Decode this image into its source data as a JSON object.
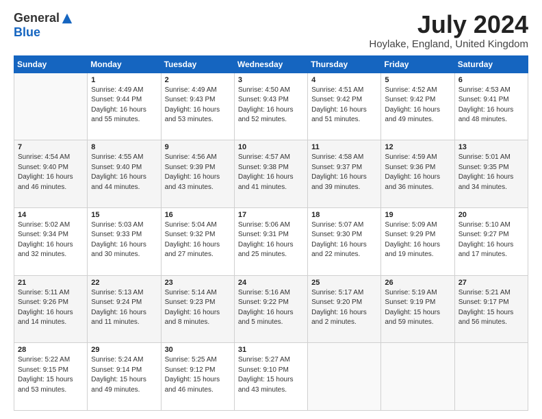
{
  "logo": {
    "general": "General",
    "blue": "Blue"
  },
  "title": "July 2024",
  "location": "Hoylake, England, United Kingdom",
  "days_of_week": [
    "Sunday",
    "Monday",
    "Tuesday",
    "Wednesday",
    "Thursday",
    "Friday",
    "Saturday"
  ],
  "weeks": [
    [
      {
        "day": "",
        "info": ""
      },
      {
        "day": "1",
        "info": "Sunrise: 4:49 AM\nSunset: 9:44 PM\nDaylight: 16 hours\nand 55 minutes."
      },
      {
        "day": "2",
        "info": "Sunrise: 4:49 AM\nSunset: 9:43 PM\nDaylight: 16 hours\nand 53 minutes."
      },
      {
        "day": "3",
        "info": "Sunrise: 4:50 AM\nSunset: 9:43 PM\nDaylight: 16 hours\nand 52 minutes."
      },
      {
        "day": "4",
        "info": "Sunrise: 4:51 AM\nSunset: 9:42 PM\nDaylight: 16 hours\nand 51 minutes."
      },
      {
        "day": "5",
        "info": "Sunrise: 4:52 AM\nSunset: 9:42 PM\nDaylight: 16 hours\nand 49 minutes."
      },
      {
        "day": "6",
        "info": "Sunrise: 4:53 AM\nSunset: 9:41 PM\nDaylight: 16 hours\nand 48 minutes."
      }
    ],
    [
      {
        "day": "7",
        "info": "Sunrise: 4:54 AM\nSunset: 9:40 PM\nDaylight: 16 hours\nand 46 minutes."
      },
      {
        "day": "8",
        "info": "Sunrise: 4:55 AM\nSunset: 9:40 PM\nDaylight: 16 hours\nand 44 minutes."
      },
      {
        "day": "9",
        "info": "Sunrise: 4:56 AM\nSunset: 9:39 PM\nDaylight: 16 hours\nand 43 minutes."
      },
      {
        "day": "10",
        "info": "Sunrise: 4:57 AM\nSunset: 9:38 PM\nDaylight: 16 hours\nand 41 minutes."
      },
      {
        "day": "11",
        "info": "Sunrise: 4:58 AM\nSunset: 9:37 PM\nDaylight: 16 hours\nand 39 minutes."
      },
      {
        "day": "12",
        "info": "Sunrise: 4:59 AM\nSunset: 9:36 PM\nDaylight: 16 hours\nand 36 minutes."
      },
      {
        "day": "13",
        "info": "Sunrise: 5:01 AM\nSunset: 9:35 PM\nDaylight: 16 hours\nand 34 minutes."
      }
    ],
    [
      {
        "day": "14",
        "info": "Sunrise: 5:02 AM\nSunset: 9:34 PM\nDaylight: 16 hours\nand 32 minutes."
      },
      {
        "day": "15",
        "info": "Sunrise: 5:03 AM\nSunset: 9:33 PM\nDaylight: 16 hours\nand 30 minutes."
      },
      {
        "day": "16",
        "info": "Sunrise: 5:04 AM\nSunset: 9:32 PM\nDaylight: 16 hours\nand 27 minutes."
      },
      {
        "day": "17",
        "info": "Sunrise: 5:06 AM\nSunset: 9:31 PM\nDaylight: 16 hours\nand 25 minutes."
      },
      {
        "day": "18",
        "info": "Sunrise: 5:07 AM\nSunset: 9:30 PM\nDaylight: 16 hours\nand 22 minutes."
      },
      {
        "day": "19",
        "info": "Sunrise: 5:09 AM\nSunset: 9:29 PM\nDaylight: 16 hours\nand 19 minutes."
      },
      {
        "day": "20",
        "info": "Sunrise: 5:10 AM\nSunset: 9:27 PM\nDaylight: 16 hours\nand 17 minutes."
      }
    ],
    [
      {
        "day": "21",
        "info": "Sunrise: 5:11 AM\nSunset: 9:26 PM\nDaylight: 16 hours\nand 14 minutes."
      },
      {
        "day": "22",
        "info": "Sunrise: 5:13 AM\nSunset: 9:24 PM\nDaylight: 16 hours\nand 11 minutes."
      },
      {
        "day": "23",
        "info": "Sunrise: 5:14 AM\nSunset: 9:23 PM\nDaylight: 16 hours\nand 8 minutes."
      },
      {
        "day": "24",
        "info": "Sunrise: 5:16 AM\nSunset: 9:22 PM\nDaylight: 16 hours\nand 5 minutes."
      },
      {
        "day": "25",
        "info": "Sunrise: 5:17 AM\nSunset: 9:20 PM\nDaylight: 16 hours\nand 2 minutes."
      },
      {
        "day": "26",
        "info": "Sunrise: 5:19 AM\nSunset: 9:19 PM\nDaylight: 15 hours\nand 59 minutes."
      },
      {
        "day": "27",
        "info": "Sunrise: 5:21 AM\nSunset: 9:17 PM\nDaylight: 15 hours\nand 56 minutes."
      }
    ],
    [
      {
        "day": "28",
        "info": "Sunrise: 5:22 AM\nSunset: 9:15 PM\nDaylight: 15 hours\nand 53 minutes."
      },
      {
        "day": "29",
        "info": "Sunrise: 5:24 AM\nSunset: 9:14 PM\nDaylight: 15 hours\nand 49 minutes."
      },
      {
        "day": "30",
        "info": "Sunrise: 5:25 AM\nSunset: 9:12 PM\nDaylight: 15 hours\nand 46 minutes."
      },
      {
        "day": "31",
        "info": "Sunrise: 5:27 AM\nSunset: 9:10 PM\nDaylight: 15 hours\nand 43 minutes."
      },
      {
        "day": "",
        "info": ""
      },
      {
        "day": "",
        "info": ""
      },
      {
        "day": "",
        "info": ""
      }
    ]
  ]
}
